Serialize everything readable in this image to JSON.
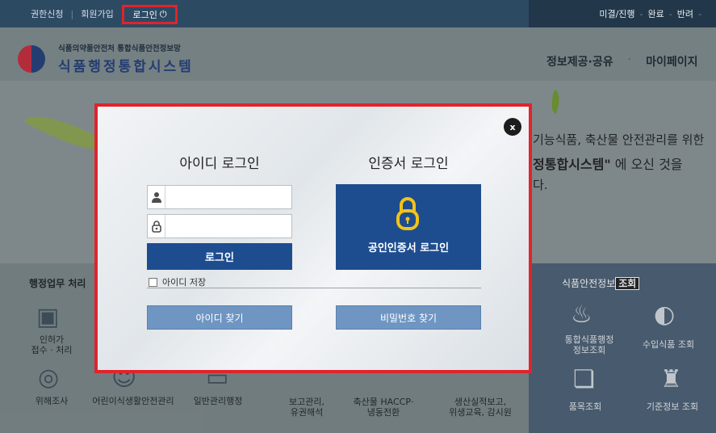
{
  "topbar": {
    "links": [
      "권한신청",
      "회원가입"
    ],
    "login_label": "로그인",
    "status": [
      "미결/진행",
      "완료",
      "반려"
    ]
  },
  "header": {
    "org": "식품의약품안전처 통합식품안전정보망",
    "title": "식품행정통합시스템",
    "nav": [
      "정보제공·공유",
      "마이페이지"
    ]
  },
  "hero": {
    "line1": "기능식품, 축산물 안전관리를 위한",
    "line2_bold": "정통합",
    "line2_rest": "시스템\" 에 오신 것을",
    "line3": "다."
  },
  "lower": {
    "work_title": "행정업무 처리",
    "info_title_prefix": "식품안전정보",
    "info_title_tag": "조회",
    "items_left": [
      "인허가\n접수 · 처리",
      "위해조사",
      "어린이식생활안전관리",
      "일반관리행정",
      "보고관리,\n유권해석",
      "축산물 HACCP·\n냉동전환",
      "생산실적보고,\n위생교육, 감시원"
    ],
    "items_right": [
      "통합식품행정\n정보조회",
      "수입식품 조회",
      "품목조회",
      "기준정보 조회"
    ]
  },
  "modal": {
    "close_label": "x",
    "id_heading": "아이디 로그인",
    "cert_heading": "인증서 로그인",
    "username_placeholder": "",
    "password_placeholder": "",
    "login_button": "로그인",
    "cert_button": "공인인증서 로그인",
    "save_id_label": "아이디 저장",
    "find_id_button": "아이디 찾기",
    "find_pw_button": "비밀번호 찾기"
  },
  "colors": {
    "accent_red": "#e0242c",
    "primary_blue": "#1e4d8f",
    "secondary_blue": "#6f96c2",
    "lock_yellow": "#f2c318"
  }
}
